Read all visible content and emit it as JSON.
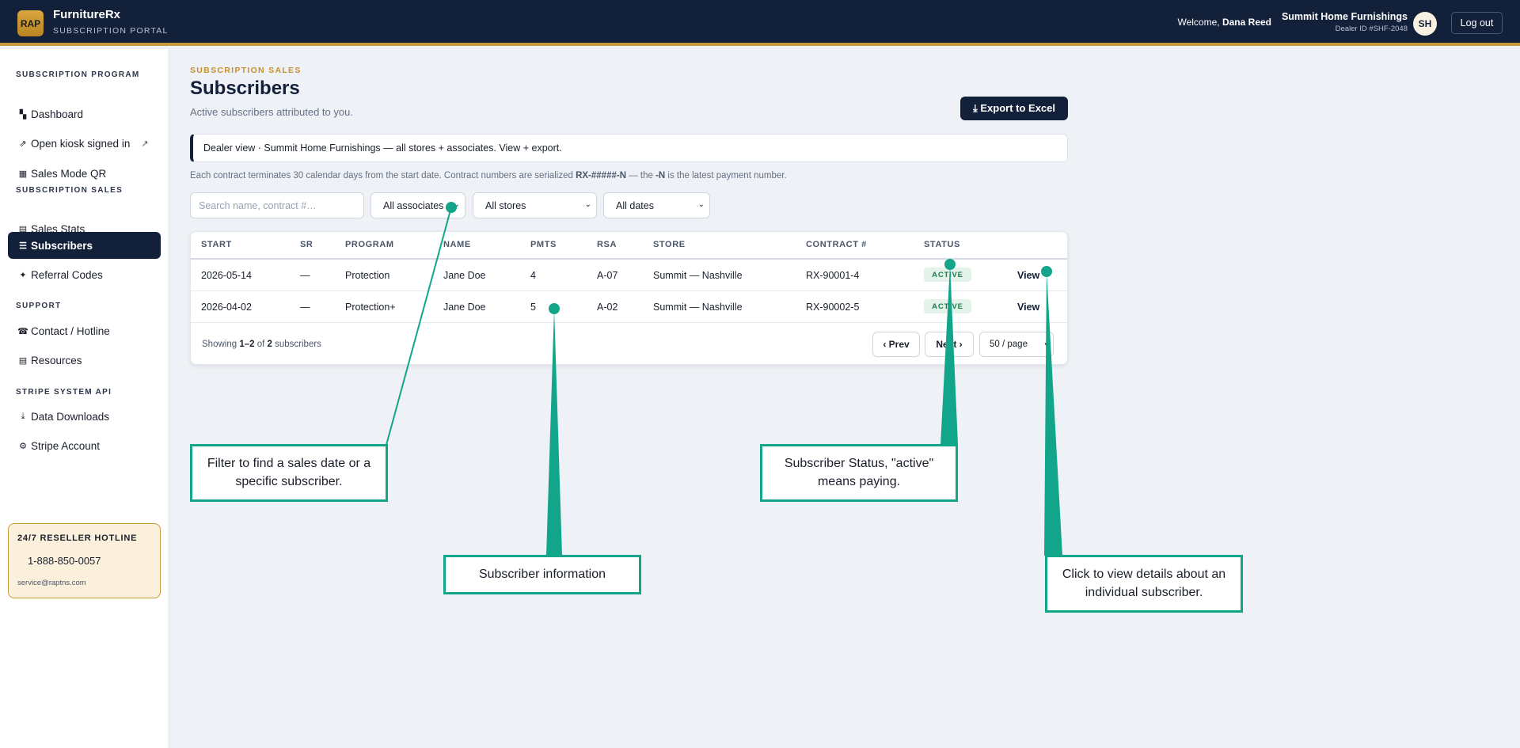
{
  "header": {
    "logo_text": "RAP",
    "brand": "FurnitureRx",
    "brand_sub": "SUBSCRIPTION PORTAL",
    "welcome_prefix": "Welcome,",
    "user_name": "Dana Reed",
    "dealer_name": "Summit Home Furnishings",
    "dealer_id": "Dealer ID #SHF-2048",
    "avatar_initials": "SH",
    "logout_label": "Log out"
  },
  "sidebar": {
    "sections": [
      {
        "title": "SUBSCRIPTION PROGRAM"
      },
      {
        "title": "SUBSCRIPTION SALES"
      },
      {
        "title": "SUPPORT"
      },
      {
        "title": "STRIPE SYSTEM API"
      }
    ],
    "items": [
      {
        "icon": "▚",
        "label": "Dashboard"
      },
      {
        "icon": "⇗",
        "label": "Open kiosk signed in",
        "ext": "↗"
      },
      {
        "icon": "▦",
        "label": "Sales Mode QR"
      },
      {
        "icon": "▤",
        "label": "Sales Stats"
      },
      {
        "icon": "☰",
        "label": "Subscribers"
      },
      {
        "icon": "✦",
        "label": "Referral Codes"
      },
      {
        "icon": "☎",
        "label": "Contact / Hotline"
      },
      {
        "icon": "▤",
        "label": "Resources"
      },
      {
        "icon": "⤓",
        "label": "Data Downloads"
      },
      {
        "icon": "⚙",
        "label": "Stripe Account"
      }
    ],
    "hotline": {
      "title": "24/7 RESELLER HOTLINE",
      "phone": "1-888-850-0057",
      "email": "service@raptns.com"
    }
  },
  "main": {
    "eyebrow": "SUBSCRIPTION SALES",
    "title": "Subscribers",
    "subtitle": "Active subscribers attributed to you.",
    "export_label": "⤓ Export to Excel",
    "notice": "Dealer view · Summit Home Furnishings — all stores + associates. View + export.",
    "note_prefix": "Each contract terminates 30 calendar days from the start date. Contract numbers are serialized ",
    "note_format": "RX-#####-N",
    "note_mid": " — the ",
    "note_suffix_code": "-N",
    "note_end": " is the latest payment number.",
    "filters": {
      "search_placeholder": "Search name, contract #…",
      "associates": "All associates",
      "stores": "All stores",
      "dates": "All dates"
    },
    "table": {
      "columns": [
        "START",
        "SR",
        "PROGRAM",
        "NAME",
        "PMTS",
        "RSA",
        "STORE",
        "CONTRACT #",
        "STATUS"
      ],
      "rows": [
        {
          "start": "2026-05-14",
          "sr": "—",
          "program": "Protection",
          "name": "Jane Doe",
          "pmts": "4",
          "rsa": "A-07",
          "store": "Summit — Nashville",
          "contract": "RX-90001-4",
          "status": "ACTIVE",
          "action": "View"
        },
        {
          "start": "2026-04-02",
          "sr": "—",
          "program": "Protection+",
          "name": "Jane Doe",
          "pmts": "5",
          "rsa": "A-02",
          "store": "Summit — Nashville",
          "contract": "RX-90002-5",
          "status": "ACTIVE",
          "action": "View"
        }
      ],
      "showing_prefix": "Showing",
      "showing_range": "1–2",
      "showing_of": "of",
      "showing_total": "2",
      "showing_suffix": "subscribers",
      "prev_label": "‹ Prev",
      "next_label": "Next ›",
      "per_page": "50 / page"
    }
  },
  "annotations": {
    "filter": "Filter to find a sales date or a specific subscriber.",
    "info": "Subscriber information",
    "status": "Subscriber Status, \"active\" means paying.",
    "view": "Click to view details about an individual subscriber."
  },
  "colors": {
    "navy": "#13203a",
    "gold": "#c79a3c",
    "teal_annotation": "#12a58a",
    "active_green": "#1f7a4a"
  }
}
